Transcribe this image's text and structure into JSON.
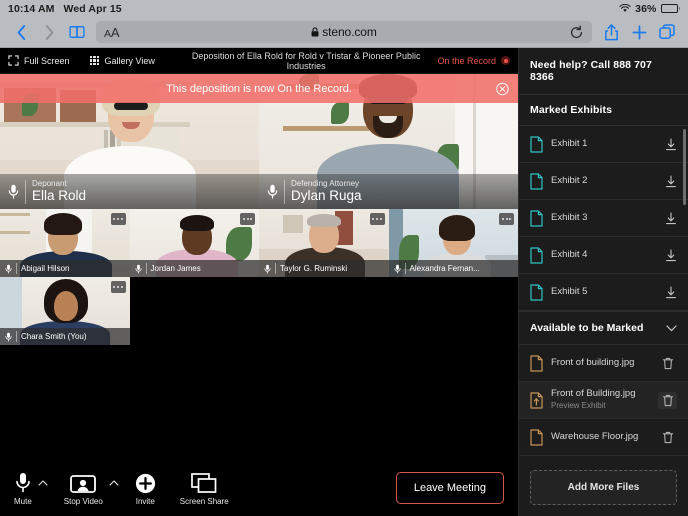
{
  "status_bar": {
    "time": "10:14 AM",
    "date": "Wed Apr 15",
    "battery_percent": "36%",
    "battery_level": 36,
    "wifi_icon": "wifi-icon"
  },
  "browser": {
    "back_icon": "chevron-left-icon",
    "forward_icon": "chevron-right-icon",
    "bookmarks_icon": "book-icon",
    "aa_label_small": "A",
    "aa_label_large": "A",
    "lock_icon": "lock-icon",
    "url": "steno.com",
    "reload_icon": "reload-icon",
    "share_icon": "share-icon",
    "new_tab_icon": "plus-icon",
    "tabs_icon": "tabs-icon"
  },
  "deposition_bar": {
    "full_screen_label": "Full Screen",
    "full_screen_icon": "fullscreen-icon",
    "gallery_view_label": "Gallery View",
    "gallery_view_icon": "grid-icon",
    "title": "Deposition of Ella Rold for Rold v Tristar & Pioneer Public Industries",
    "on_the_record_label": "On the Record",
    "record_icon": "record-dot-icon"
  },
  "banner": {
    "message": "This deposition is now On the Record.",
    "close_icon": "close-circle-icon",
    "color": "#f06e69"
  },
  "participants": {
    "main": [
      {
        "role": "Deponant",
        "name": "Ella Rold",
        "muted": true,
        "active_speaker": true
      },
      {
        "role": "Defending Attorney",
        "name": "Dylan Ruga",
        "muted": true,
        "active_speaker": false
      }
    ],
    "small": [
      {
        "name": "Abigail Hilson"
      },
      {
        "name": "Jordan James"
      },
      {
        "name": "Taylor G. Ruminski"
      },
      {
        "name": "Alexandra Fernan..."
      },
      {
        "name": "Chara Smith (You)"
      }
    ],
    "mic_icon": "microphone-icon",
    "more_icon": "more-options-icon"
  },
  "controls": {
    "mute_label": "Mute",
    "mute_icon": "microphone-icon",
    "stop_video_label": "Stop Video",
    "stop_video_icon": "video-camera-icon",
    "invite_label": "Invite",
    "invite_icon": "plus-circle-icon",
    "screen_share_label": "Screen Share",
    "screen_share_icon": "screen-share-icon",
    "caret_icon": "chevron-up-icon",
    "leave_label": "Leave Meeting",
    "leave_color": "#d9554f"
  },
  "sidebar": {
    "help_text": "Need help? Call 888 707 8366",
    "marked_title": "Marked Exhibits",
    "marked_icon_color": "#2ec4c4",
    "download_icon": "download-icon",
    "marked_exhibits": [
      {
        "name": "Exhibit 1"
      },
      {
        "name": "Exhibit 2"
      },
      {
        "name": "Exhibit 3"
      },
      {
        "name": "Exhibit 4"
      },
      {
        "name": "Exhibit 5"
      }
    ],
    "available_title": "Available to be Marked",
    "collapse_icon": "chevron-down-icon",
    "available_icon_color": "#c89455",
    "trash_icon": "trash-icon",
    "available_files": [
      {
        "name": "Front of building.jpg",
        "sub": "",
        "icon": "file-icon",
        "highlighted": false
      },
      {
        "name": "Front of Building.jpg",
        "sub": "Preview Exhibit",
        "icon": "file-upload-icon",
        "highlighted": true
      },
      {
        "name": "Warehouse Floor.jpg",
        "sub": "",
        "icon": "file-icon",
        "highlighted": false
      }
    ],
    "add_files_label": "Add More Files"
  }
}
